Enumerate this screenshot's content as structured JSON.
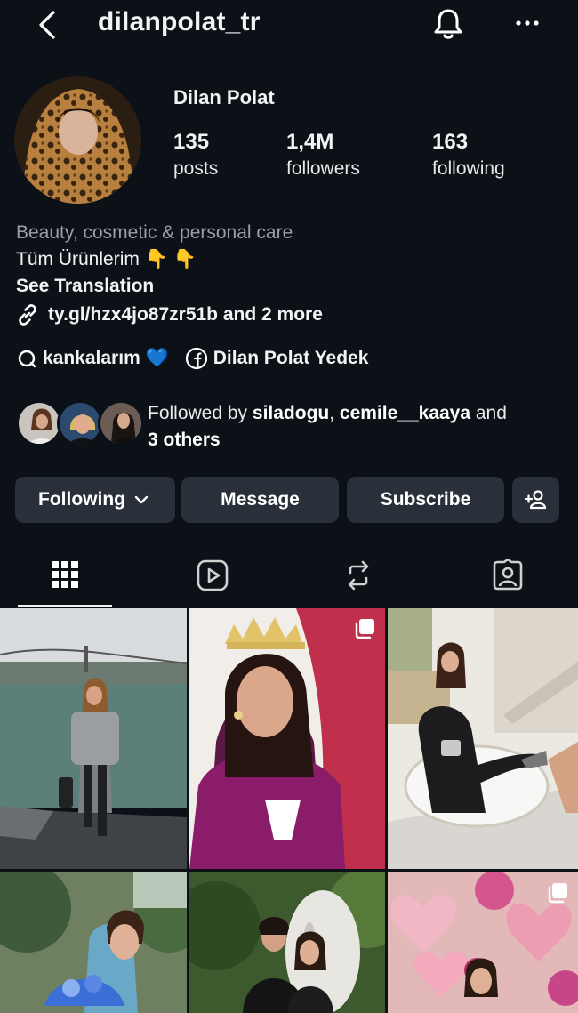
{
  "header": {
    "username": "dilanpolat_tr"
  },
  "profile": {
    "display_name": "Dilan Polat",
    "stats": [
      {
        "value": "135",
        "label": "posts"
      },
      {
        "value": "1,4M",
        "label": "followers"
      },
      {
        "value": "163",
        "label": "following"
      }
    ],
    "category": "Beauty, cosmetic & personal care",
    "bio_line": "Tüm Ürünlerim 👇 👇",
    "see_translation": "See Translation",
    "link_text": "ty.gl/hzx4jo87zr51b and 2 more",
    "threads_label": "kankalarım 💙",
    "facebook_label": "Dilan Polat Yedek"
  },
  "followed_by": {
    "prefix": "Followed by ",
    "user1": "siladogu",
    "separator": ", ",
    "user2": "cemile__kaaya",
    "suffix_and": " and",
    "others": "3 others"
  },
  "actions": {
    "following": "Following",
    "message": "Message",
    "subscribe": "Subscribe"
  },
  "tabs": [
    "posts-grid",
    "reels",
    "reposts",
    "tagged"
  ],
  "colors": {
    "background": "#0c1118",
    "button": "#2a3039",
    "muted_text": "#9aa0a7"
  }
}
